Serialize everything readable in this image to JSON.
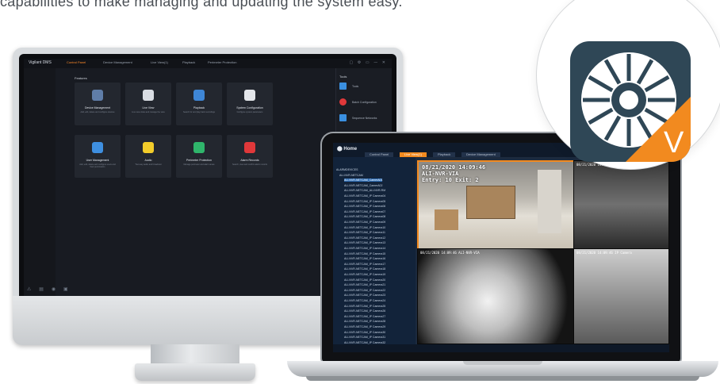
{
  "tagline": "capabilities to make managing and updating the system easy.",
  "monitor_app": {
    "brand": "Vigilant DMS",
    "tabs": [
      "Control Panel",
      "Device Management",
      "Live View(1)",
      "Playback",
      "Perimeter Protection"
    ],
    "section_title": "Features",
    "tiles": [
      {
        "title": "Device Management",
        "desc": "Add, edit, delete and configure devices",
        "icon": "device-icon",
        "color": "#5f7da8"
      },
      {
        "title": "Live View",
        "desc": "Live view video and manage the view",
        "icon": "camera-icon",
        "color": "#d9dde3"
      },
      {
        "title": "Playback",
        "desc": "Search for and play back recordings",
        "icon": "playback-icon",
        "color": "#3e86d6"
      },
      {
        "title": "System Configuration",
        "desc": "Configure system parameters",
        "icon": "gear-icon",
        "color": "#e3e6ea"
      },
      {
        "title": "User Management",
        "desc": "Add, edit, delete and configure users and their permissions",
        "icon": "users-icon",
        "color": "#3e8fe0"
      },
      {
        "title": "Audio",
        "desc": "Two-way audio and broadcast",
        "icon": "audio-icon",
        "color": "#f2cc2a"
      },
      {
        "title": "Perimeter Protection",
        "desc": "Manage perimeter and alarm areas",
        "icon": "perimeter-icon",
        "color": "#2fb56b"
      },
      {
        "title": "Alarm Records",
        "desc": "Search, view and confirm alarm records",
        "icon": "alarm-icon",
        "color": "#e0383a"
      }
    ],
    "right_panel": {
      "title": "Tools",
      "items": [
        {
          "label": "Tools",
          "icon": "monitor-icon",
          "color": "#3a8fe0"
        },
        {
          "label": "Batch Configuration",
          "icon": "batch-icon",
          "color": "#e0383a"
        },
        {
          "label": "Sequence Networks",
          "icon": "network-icon",
          "color": "#3a8fe0"
        }
      ]
    }
  },
  "laptop_app": {
    "home_label": "Home",
    "tabs": [
      "Control Panel",
      "Live View(1)",
      "Playback",
      "Device Management"
    ],
    "active_tab": 1,
    "tree": [
      "ALARMDEVICES",
      "ALI-NVR-NETCAM",
      "ALI-NVR-NETCAM_CamerA01",
      "ALI-NVR-NETCAM_CamerA02",
      "ALI-NVR-NETCAM_ALI-NVR-RM",
      "ALI-NVR-NETCAM_IP Camera04",
      "ALI-NVR-NETCAM_IP Camera05",
      "ALI-NVR-NETCAM_IP Camera06",
      "ALI-NVR-NETCAM_IP Camera07",
      "ALI-NVR-NETCAM_IP Camera08",
      "ALI-NVR-NETCAM_IP Camera09",
      "ALI-NVR-NETCAM_IP Camera10",
      "ALI-NVR-NETCAM_IP Camera11",
      "ALI-NVR-NETCAM_IP Camera12",
      "ALI-NVR-NETCAM_IP Camera13",
      "ALI-NVR-NETCAM_IP Camera14",
      "ALI-NVR-NETCAM_IP Camera15",
      "ALI-NVR-NETCAM_IP Camera16",
      "ALI-NVR-NETCAM_IP Camera17",
      "ALI-NVR-NETCAM_IP Camera18",
      "ALI-NVR-NETCAM_IP Camera19",
      "ALI-NVR-NETCAM_IP Camera20",
      "ALI-NVR-NETCAM_IP Camera21",
      "ALI-NVR-NETCAM_IP Camera22",
      "ALI-NVR-NETCAM_IP Camera23",
      "ALI-NVR-NETCAM_IP Camera24",
      "ALI-NVR-NETCAM_IP Camera25",
      "ALI-NVR-NETCAM_IP Camera26",
      "ALI-NVR-NETCAM_IP Camera27",
      "ALI-NVR-NETCAM_IP Camera28",
      "ALI-NVR-NETCAM_IP Camera29",
      "ALI-NVR-NETCAM_IP Camera30",
      "ALI-NVR-NETCAM_IP Camera31",
      "ALI-NVR-NETCAM_IP Camera32"
    ],
    "selected_tree_index": 2,
    "camera_main": {
      "line1": "08/21/2020 14:09:46",
      "line2": "ALI-NVR-VIA",
      "line3": "Entry: 10 Exit: 2"
    },
    "camera_small": [
      {
        "text": "08/21/2020 14:09:46"
      },
      {
        "text": "08/21/2020 14:09:46 ALI-NVR-VIA"
      },
      {
        "text": "08/21/2020 14:09:46"
      },
      {
        "text": "08/21/2020 14:09:46 IP Camera"
      }
    ]
  },
  "app_badge": {
    "letter": "V",
    "accent": "#f28a1f",
    "icon": "vigilant-shutter-icon"
  }
}
